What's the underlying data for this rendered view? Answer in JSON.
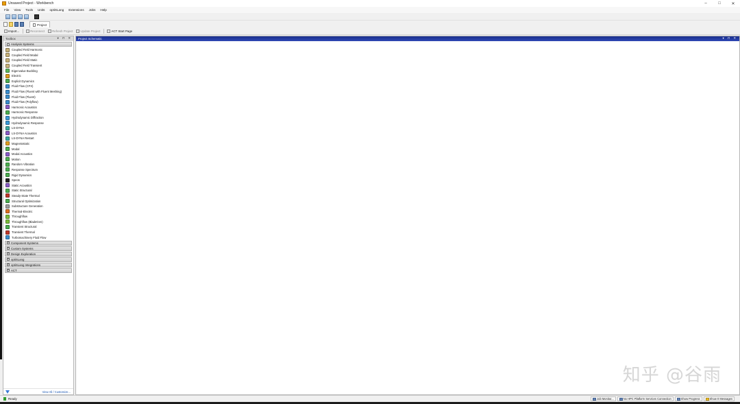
{
  "window": {
    "title": "Unsaved Project - Workbench",
    "controls": [
      "–",
      "□",
      "✕"
    ]
  },
  "menu": [
    "File",
    "View",
    "Tools",
    "Units",
    "optiSLang",
    "Extensions",
    "Jobs",
    "Help"
  ],
  "toolbar": {
    "tab_label": "Project"
  },
  "project_toolbar": {
    "import": "Import...",
    "reconnect": "Reconnect",
    "refresh": "Refresh Project",
    "update": "Update Project",
    "act_start": "ACT Start Page"
  },
  "toolbox": {
    "title": "Toolbox",
    "header_controls": "▾ ⊓ ✕",
    "analysis_group": "Analysis Systems",
    "systems": [
      {
        "label": "Coupled Field Harmonic",
        "color": "#c8b27a"
      },
      {
        "label": "Coupled Field Modal",
        "color": "#c8b27a"
      },
      {
        "label": "Coupled Field Static",
        "color": "#c8b27a"
      },
      {
        "label": "Coupled Field Transient",
        "color": "#c8b27a"
      },
      {
        "label": "Eigenvalue Buckling",
        "color": "#5cb85c"
      },
      {
        "label": "Electric",
        "color": "#e0a020"
      },
      {
        "label": "Explicit Dynamics",
        "color": "#4caf50"
      },
      {
        "label": "Fluid Flow (CFX)",
        "color": "#3a8fd0"
      },
      {
        "label": "Fluid Flow (Fluent with Fluent Meshing)",
        "color": "#3a8fd0"
      },
      {
        "label": "Fluid Flow (Fluent)",
        "color": "#3a8fd0"
      },
      {
        "label": "Fluid Flow (Polyflow)",
        "color": "#3a8fd0"
      },
      {
        "label": "Harmonic Acoustics",
        "color": "#8a5cc8"
      },
      {
        "label": "Harmonic Response",
        "color": "#4caf50"
      },
      {
        "label": "Hydrodynamic Diffraction",
        "color": "#3a9ad9"
      },
      {
        "label": "Hydrodynamic Response",
        "color": "#3a9ad9"
      },
      {
        "label": "LS-DYNA",
        "color": "#3aa8a0"
      },
      {
        "label": "LS-DYNA Acoustics",
        "color": "#8a5cc8"
      },
      {
        "label": "LS-DYNA Restart",
        "color": "#3aa8a0"
      },
      {
        "label": "Magnetostatic",
        "color": "#e0a020"
      },
      {
        "label": "Modal",
        "color": "#4caf50"
      },
      {
        "label": "Modal Acoustics",
        "color": "#8a5cc8"
      },
      {
        "label": "Motion",
        "color": "#4caf50"
      },
      {
        "label": "Random Vibration",
        "color": "#4caf50"
      },
      {
        "label": "Response Spectrum",
        "color": "#4caf50"
      },
      {
        "label": "Rigid Dynamics",
        "color": "#4caf50"
      },
      {
        "label": "Speos",
        "color": "#222222"
      },
      {
        "label": "Static Acoustics",
        "color": "#8a5cc8"
      },
      {
        "label": "Static Structural",
        "color": "#4caf50"
      },
      {
        "label": "Steady-State Thermal",
        "color": "#c0392b"
      },
      {
        "label": "Structural Optimization",
        "color": "#4caf50"
      },
      {
        "label": "Substructure Generation",
        "color": "#9e9e9e"
      },
      {
        "label": "Thermal-Electric",
        "color": "#e07020"
      },
      {
        "label": "Throughflow",
        "color": "#7bbf3a"
      },
      {
        "label": "Throughflow (BladeGen)",
        "color": "#7bbf3a"
      },
      {
        "label": "Transient Structural",
        "color": "#4caf50"
      },
      {
        "label": "Transient Thermal",
        "color": "#c0392b"
      },
      {
        "label": "Turbomachinery Fluid Flow",
        "color": "#3a8fd0"
      }
    ],
    "other_groups": [
      "Component Systems",
      "Custom Systems",
      "Design Exploration",
      "optiSLang",
      "optiSLang Integrations",
      "ACT"
    ],
    "view_all": "View All / Customize..."
  },
  "schematic": {
    "title": "Project Schematic",
    "header_controls": "▾ ⊓ ✕",
    "watermark": "知乎 @谷雨"
  },
  "status": {
    "ready": "Ready",
    "job_monitor": "Job Monitor...",
    "hpc": "No HPC Platform Services Connection",
    "show_progress": "Show Progress",
    "show_messages": "Show 0 Messages"
  }
}
